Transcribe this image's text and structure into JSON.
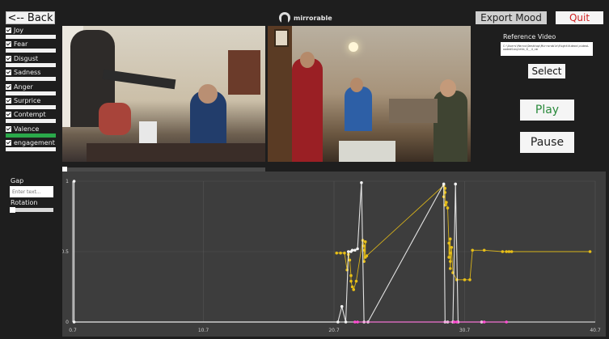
{
  "header": {
    "back_label": "<-- Back",
    "brand": "mirrorable",
    "export_label": "Export Mood",
    "quit_label": "Quit"
  },
  "emotions": [
    {
      "label": "Joy",
      "checked": true
    },
    {
      "label": "Fear",
      "checked": true
    },
    {
      "label": "Disgust",
      "checked": true
    },
    {
      "label": "Sadness",
      "checked": true
    },
    {
      "label": "Anger",
      "checked": true
    },
    {
      "label": "Surprice",
      "checked": true
    },
    {
      "label": "Contempt",
      "checked": true
    },
    {
      "label": "Valence",
      "checked": true,
      "bar": "green"
    },
    {
      "label": "engagement",
      "checked": true
    }
  ],
  "settings": {
    "gap_label": "Gap",
    "gap_placeholder": "Enter text...",
    "rotation_label": "Rotation",
    "rotation_value": 0
  },
  "reference": {
    "label": "Reference Video",
    "path": "C:\\Users\\Marco\\Desktop\\Mirrorable\\RightVideos\\videoLoadedSingleVo_0__4_cm",
    "select_label": "Select"
  },
  "player": {
    "play_label": "Play",
    "pause_label": "Pause",
    "progress": 0
  },
  "colors": {
    "joy": "#e8bf17",
    "white_series": "#f4f4f4",
    "pink_series": "#ff4dd2",
    "play_text": "#2a8a3c",
    "quit_text": "#d02020"
  },
  "chart_data": {
    "type": "scatter",
    "xlim": [
      0.7,
      40.7
    ],
    "ylim": [
      0,
      1
    ],
    "x_ticks": [
      "0.7",
      "10.7",
      "20.7",
      "30.7",
      "40.7"
    ],
    "y_ticks": [
      "0",
      "0.5",
      "1"
    ],
    "grid": true,
    "series": [
      {
        "color": "#e8bf17",
        "points": [
          [
            20.9,
            0.49
          ],
          [
            21.2,
            0.49
          ],
          [
            21.5,
            0.49
          ],
          [
            21.8,
            0.48
          ],
          [
            21.9,
            0.44
          ],
          [
            21.7,
            0.37
          ],
          [
            22.0,
            0.33
          ],
          [
            22.0,
            0.29
          ],
          [
            22.1,
            0.25
          ],
          [
            22.2,
            0.23
          ],
          [
            22.4,
            0.29
          ],
          [
            22.9,
            0.58
          ],
          [
            23.1,
            0.57
          ],
          [
            23.0,
            0.54
          ],
          [
            23.0,
            0.51
          ],
          [
            23.2,
            0.47
          ],
          [
            23.1,
            0.46
          ],
          [
            23.0,
            0.43
          ],
          [
            29.1,
            0.97
          ],
          [
            29.2,
            0.95
          ],
          [
            29.2,
            0.92
          ],
          [
            29.1,
            0.89
          ],
          [
            29.3,
            0.85
          ],
          [
            29.2,
            0.83
          ],
          [
            29.4,
            0.81
          ],
          [
            29.6,
            0.59
          ],
          [
            29.5,
            0.56
          ],
          [
            29.7,
            0.53
          ],
          [
            29.6,
            0.49
          ],
          [
            29.5,
            0.46
          ],
          [
            29.6,
            0.43
          ],
          [
            29.6,
            0.38
          ],
          [
            29.8,
            0.35
          ],
          [
            30.1,
            0.3
          ],
          [
            30.7,
            0.3
          ],
          [
            31.1,
            0.3
          ],
          [
            31.3,
            0.51
          ],
          [
            32.2,
            0.51
          ],
          [
            33.6,
            0.5
          ],
          [
            33.9,
            0.5
          ],
          [
            34.1,
            0.5
          ],
          [
            34.3,
            0.5
          ],
          [
            40.3,
            0.5
          ]
        ]
      },
      {
        "color": "#f4f4f4",
        "points": [
          [
            0.8,
            1.0
          ],
          [
            0.8,
            0.0
          ],
          [
            21.0,
            0.0
          ],
          [
            21.3,
            0.11
          ],
          [
            21.6,
            0.0
          ],
          [
            21.8,
            0.5
          ],
          [
            22.0,
            0.5
          ],
          [
            22.1,
            0.51
          ],
          [
            22.3,
            0.51
          ],
          [
            22.5,
            0.52
          ],
          [
            22.8,
            0.99
          ],
          [
            23.0,
            0.0
          ],
          [
            23.3,
            0.0
          ],
          [
            29.1,
            0.98
          ],
          [
            29.2,
            0.0
          ],
          [
            29.4,
            0.0
          ],
          [
            29.8,
            0.0
          ],
          [
            30.0,
            0.98
          ],
          [
            30.2,
            0.0
          ],
          [
            32.0,
            0.0
          ]
        ]
      },
      {
        "color": "#ff4dd2",
        "points": [
          [
            22.3,
            0.0
          ],
          [
            22.5,
            0.0
          ],
          [
            29.9,
            0.0
          ],
          [
            30.1,
            0.0
          ],
          [
            32.2,
            0.0
          ],
          [
            33.9,
            0.0
          ]
        ]
      }
    ]
  }
}
